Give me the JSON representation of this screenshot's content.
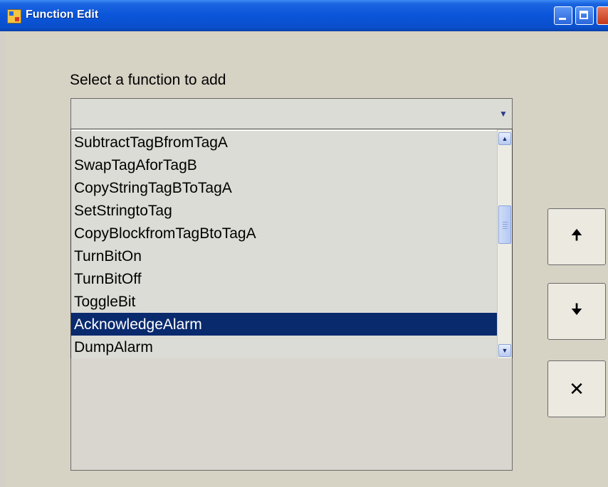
{
  "window": {
    "title": "Function Edit"
  },
  "prompt_label": "Select a function to add",
  "combo": {
    "value": "",
    "arrow_icon": "chevron-down-icon"
  },
  "function_list": {
    "items": [
      "SubtractTagBfromTagA",
      "SwapTagAforTagB",
      "CopyStringTagBToTagA",
      "SetStringtoTag",
      "CopyBlockfromTagBtoTagA",
      "TurnBitOn",
      "TurnBitOff",
      "ToggleBit",
      "AcknowledgeAlarm",
      "DumpAlarm"
    ],
    "selected": "AcknowledgeAlarm"
  },
  "buttons": {
    "move_up_glyph": "🠉",
    "move_down_glyph": "🠋",
    "close_glyph": "✕"
  },
  "colors": {
    "titlebar": "#0a55d9",
    "selection": "#0a2a6e",
    "dialog_bg": "#d6d2c4"
  }
}
